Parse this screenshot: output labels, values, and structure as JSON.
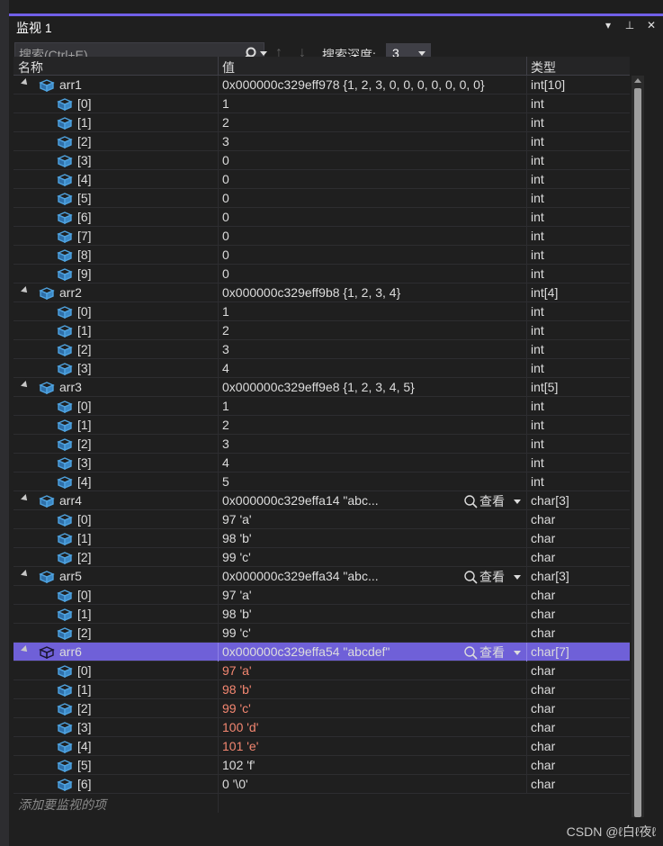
{
  "window": {
    "title": "监视 1"
  },
  "toolbar": {
    "search_placeholder": "搜索(Ctrl+E)",
    "depth_label": "搜索深度:",
    "depth_value": "3"
  },
  "columns": {
    "name": "名称",
    "value": "值",
    "type": "类型"
  },
  "view_label": "查看",
  "rows": [
    {
      "name": "arr1",
      "value": "0x000000c329eff978 {1, 2, 3, 0, 0, 0, 0, 0, 0, 0}",
      "type": "int[10]",
      "level": 0
    },
    {
      "name": "[0]",
      "value": "1",
      "type": "int",
      "level": 1
    },
    {
      "name": "[1]",
      "value": "2",
      "type": "int",
      "level": 1
    },
    {
      "name": "[2]",
      "value": "3",
      "type": "int",
      "level": 1
    },
    {
      "name": "[3]",
      "value": "0",
      "type": "int",
      "level": 1
    },
    {
      "name": "[4]",
      "value": "0",
      "type": "int",
      "level": 1
    },
    {
      "name": "[5]",
      "value": "0",
      "type": "int",
      "level": 1
    },
    {
      "name": "[6]",
      "value": "0",
      "type": "int",
      "level": 1
    },
    {
      "name": "[7]",
      "value": "0",
      "type": "int",
      "level": 1
    },
    {
      "name": "[8]",
      "value": "0",
      "type": "int",
      "level": 1
    },
    {
      "name": "[9]",
      "value": "0",
      "type": "int",
      "level": 1
    },
    {
      "name": "arr2",
      "value": "0x000000c329eff9b8 {1, 2, 3, 4}",
      "type": "int[4]",
      "level": 0
    },
    {
      "name": "[0]",
      "value": "1",
      "type": "int",
      "level": 1
    },
    {
      "name": "[1]",
      "value": "2",
      "type": "int",
      "level": 1
    },
    {
      "name": "[2]",
      "value": "3",
      "type": "int",
      "level": 1
    },
    {
      "name": "[3]",
      "value": "4",
      "type": "int",
      "level": 1
    },
    {
      "name": "arr3",
      "value": "0x000000c329eff9e8 {1, 2, 3, 4, 5}",
      "type": "int[5]",
      "level": 0
    },
    {
      "name": "[0]",
      "value": "1",
      "type": "int",
      "level": 1
    },
    {
      "name": "[1]",
      "value": "2",
      "type": "int",
      "level": 1
    },
    {
      "name": "[2]",
      "value": "3",
      "type": "int",
      "level": 1
    },
    {
      "name": "[3]",
      "value": "4",
      "type": "int",
      "level": 1
    },
    {
      "name": "[4]",
      "value": "5",
      "type": "int",
      "level": 1
    },
    {
      "name": "arr4",
      "value": "0x000000c329effa14 \"abc...",
      "type": "char[3]",
      "level": 0,
      "view": true
    },
    {
      "name": "[0]",
      "value": "97 'a'",
      "type": "char",
      "level": 1
    },
    {
      "name": "[1]",
      "value": "98 'b'",
      "type": "char",
      "level": 1
    },
    {
      "name": "[2]",
      "value": "99 'c'",
      "type": "char",
      "level": 1
    },
    {
      "name": "arr5",
      "value": "0x000000c329effa34 \"abc...",
      "type": "char[3]",
      "level": 0,
      "view": true
    },
    {
      "name": "[0]",
      "value": "97 'a'",
      "type": "char",
      "level": 1
    },
    {
      "name": "[1]",
      "value": "98 'b'",
      "type": "char",
      "level": 1
    },
    {
      "name": "[2]",
      "value": "99 'c'",
      "type": "char",
      "level": 1
    },
    {
      "name": "arr6",
      "value": "0x000000c329effa54 \"abcdef\"",
      "type": "char[7]",
      "level": 0,
      "view": true,
      "selected": true
    },
    {
      "name": "[0]",
      "value": "97 'a'",
      "type": "char",
      "level": 1,
      "changed": true
    },
    {
      "name": "[1]",
      "value": "98 'b'",
      "type": "char",
      "level": 1,
      "changed": true
    },
    {
      "name": "[2]",
      "value": "99 'c'",
      "type": "char",
      "level": 1,
      "changed": true
    },
    {
      "name": "[3]",
      "value": "100 'd'",
      "type": "char",
      "level": 1,
      "changed": true
    },
    {
      "name": "[4]",
      "value": "101 'e'",
      "type": "char",
      "level": 1,
      "changed": true
    },
    {
      "name": "[5]",
      "value": "102 'f'",
      "type": "char",
      "level": 1
    },
    {
      "name": "[6]",
      "value": "0 '\\0'",
      "type": "char",
      "level": 1
    }
  ],
  "add_watch_placeholder": "添加要监视的项",
  "watermark": "CSDN @ℓ白ℓ夜ℓ",
  "colors": {
    "accent": "#7160e8",
    "selected_row": "#6f60d8",
    "changed_value": "#f48771",
    "cube_icon": "#4fa3e0"
  },
  "icons": {
    "cube": "object-cube-icon",
    "search": "search-icon",
    "expander": "collapse-triangle-icon"
  }
}
